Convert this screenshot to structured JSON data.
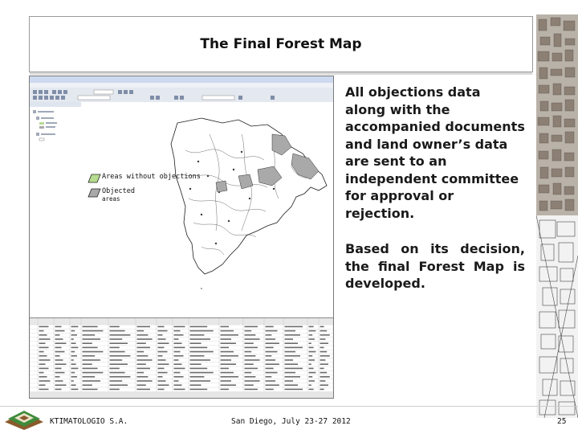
{
  "slide": {
    "title": "The Final Forest Map",
    "bullets": [
      "All objections data along with the accompanied documents and land owner’s data are sent to an independent committee for approval or rejection.",
      "Based on its decision, the final Forest Map is developed."
    ]
  },
  "screenshot": {
    "legend": {
      "areas_without_objections": "Areas without objections",
      "objected_areas_line1": "Objected",
      "objected_areas_line2": "areas"
    }
  },
  "footer": {
    "organization": "KTIMATOLOGIO S.A.",
    "event": "San Diego, July 23-27 2012",
    "page_number": "25"
  },
  "colors": {
    "title_border": "#9a9a9a",
    "text": "#1a1a1a",
    "logo_green": "#3f8a3a",
    "logo_brown": "#8b5a2b",
    "objected_fill": "#a9a9a9",
    "map_fill": "#b5dc8f"
  }
}
